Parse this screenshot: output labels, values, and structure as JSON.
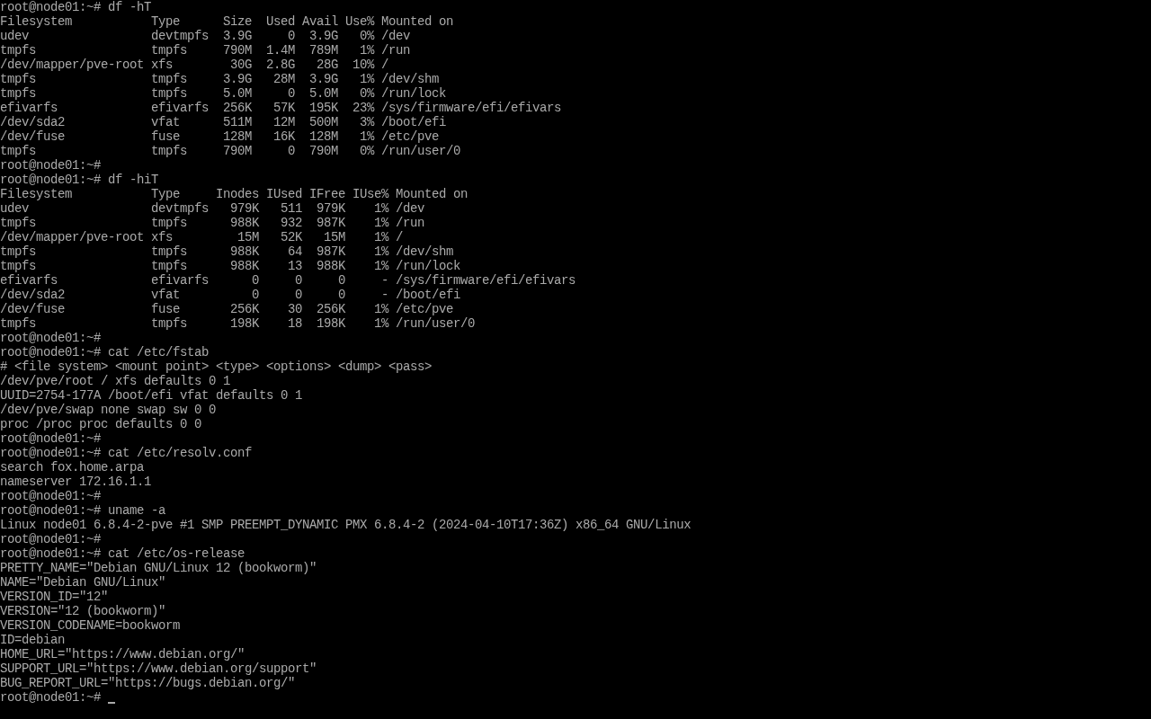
{
  "terminal": {
    "session": [
      {
        "prompt": "root@node01:~#",
        "command": "df -hT",
        "output": {
          "kind": "table",
          "columns": [
            "Filesystem",
            "Type",
            "Size",
            "Used",
            "Avail",
            "Use%",
            "Mounted on"
          ],
          "rows": [
            [
              "udev",
              "devtmpfs",
              "3.9G",
              "0",
              "3.9G",
              "0%",
              "/dev"
            ],
            [
              "tmpfs",
              "tmpfs",
              "790M",
              "1.4M",
              "789M",
              "1%",
              "/run"
            ],
            [
              "/dev/mapper/pve-root",
              "xfs",
              "30G",
              "2.8G",
              "28G",
              "10%",
              "/"
            ],
            [
              "tmpfs",
              "tmpfs",
              "3.9G",
              "28M",
              "3.9G",
              "1%",
              "/dev/shm"
            ],
            [
              "tmpfs",
              "tmpfs",
              "5.0M",
              "0",
              "5.0M",
              "0%",
              "/run/lock"
            ],
            [
              "efivarfs",
              "efivarfs",
              "256K",
              "57K",
              "195K",
              "23%",
              "/sys/firmware/efi/efivars"
            ],
            [
              "/dev/sda2",
              "vfat",
              "511M",
              "12M",
              "500M",
              "3%",
              "/boot/efi"
            ],
            [
              "/dev/fuse",
              "fuse",
              "128M",
              "16K",
              "128M",
              "1%",
              "/etc/pve"
            ],
            [
              "tmpfs",
              "tmpfs",
              "790M",
              "0",
              "790M",
              "0%",
              "/run/user/0"
            ]
          ]
        }
      },
      {
        "prompt": "root@node01:~#"
      },
      {
        "prompt": "root@node01:~#",
        "command": "df -hiT",
        "output": {
          "kind": "table",
          "columns": [
            "Filesystem",
            "Type",
            "Inodes",
            "IUsed",
            "IFree",
            "IUse%",
            "Mounted on"
          ],
          "rows": [
            [
              "udev",
              "devtmpfs",
              "979K",
              "511",
              "979K",
              "1%",
              "/dev"
            ],
            [
              "tmpfs",
              "tmpfs",
              "988K",
              "932",
              "987K",
              "1%",
              "/run"
            ],
            [
              "/dev/mapper/pve-root",
              "xfs",
              "15M",
              "52K",
              "15M",
              "1%",
              "/"
            ],
            [
              "tmpfs",
              "tmpfs",
              "988K",
              "64",
              "987K",
              "1%",
              "/dev/shm"
            ],
            [
              "tmpfs",
              "tmpfs",
              "988K",
              "13",
              "988K",
              "1%",
              "/run/lock"
            ],
            [
              "efivarfs",
              "efivarfs",
              "0",
              "0",
              "0",
              "-",
              "/sys/firmware/efi/efivars"
            ],
            [
              "/dev/sda2",
              "vfat",
              "0",
              "0",
              "0",
              "-",
              "/boot/efi"
            ],
            [
              "/dev/fuse",
              "fuse",
              "256K",
              "30",
              "256K",
              "1%",
              "/etc/pve"
            ],
            [
              "tmpfs",
              "tmpfs",
              "198K",
              "18",
              "198K",
              "1%",
              "/run/user/0"
            ]
          ]
        }
      },
      {
        "prompt": "root@node01:~#"
      },
      {
        "prompt": "root@node01:~#",
        "command": "cat /etc/fstab",
        "output": {
          "kind": "text",
          "lines": [
            "# <file system> <mount point> <type> <options> <dump> <pass>",
            "/dev/pve/root / xfs defaults 0 1",
            "UUID=2754-177A /boot/efi vfat defaults 0 1",
            "/dev/pve/swap none swap sw 0 0",
            "proc /proc proc defaults 0 0"
          ]
        }
      },
      {
        "prompt": "root@node01:~#"
      },
      {
        "prompt": "root@node01:~#",
        "command": "cat /etc/resolv.conf",
        "output": {
          "kind": "text",
          "lines": [
            "search fox.home.arpa",
            "nameserver 172.16.1.1"
          ]
        }
      },
      {
        "prompt": "root@node01:~#"
      },
      {
        "prompt": "root@node01:~#",
        "command": "uname -a",
        "output": {
          "kind": "text",
          "lines": [
            "Linux node01 6.8.4-2-pve #1 SMP PREEMPT_DYNAMIC PMX 6.8.4-2 (2024-04-10T17:36Z) x86_64 GNU/Linux"
          ]
        }
      },
      {
        "prompt": "root@node01:~#"
      },
      {
        "prompt": "root@node01:~#",
        "command": "cat /etc/os-release",
        "output": {
          "kind": "text",
          "lines": [
            "PRETTY_NAME=\"Debian GNU/Linux 12 (bookworm)\"",
            "NAME=\"Debian GNU/Linux\"",
            "VERSION_ID=\"12\"",
            "VERSION=\"12 (bookworm)\"",
            "VERSION_CODENAME=bookworm",
            "ID=debian",
            "HOME_URL=\"https://www.debian.org/\"",
            "SUPPORT_URL=\"https://www.debian.org/support\"",
            "BUG_REPORT_URL=\"https://bugs.debian.org/\""
          ]
        }
      }
    ],
    "input_line": {
      "prompt": "root@node01:~#",
      "cursor": true
    }
  }
}
